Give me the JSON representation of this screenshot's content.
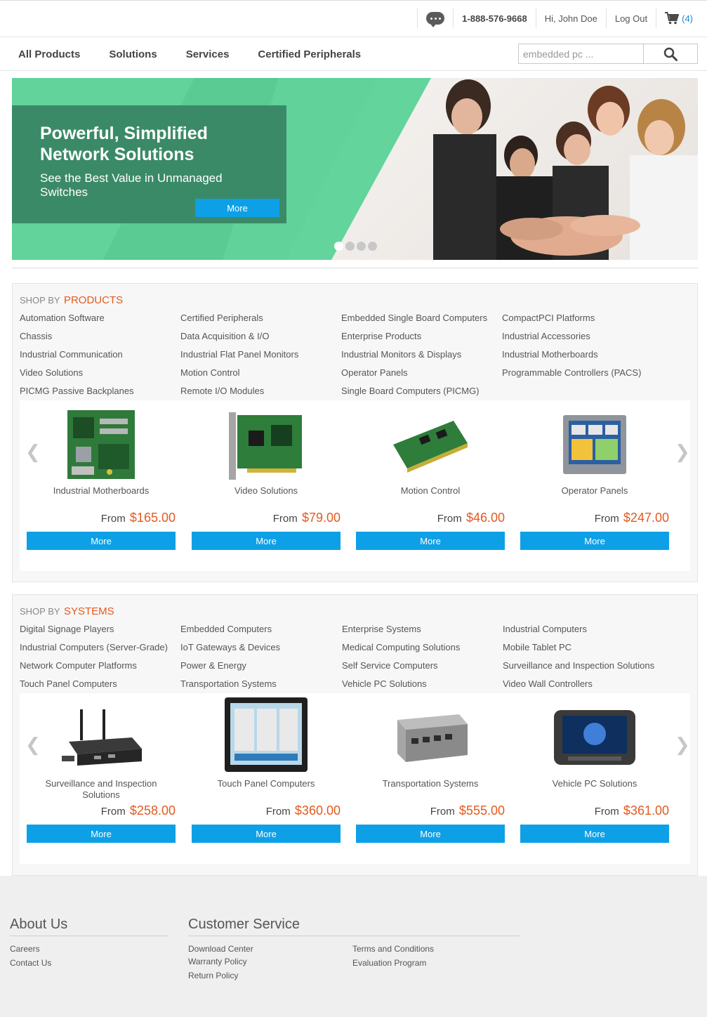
{
  "topbar": {
    "phone": "1-888-576-9668",
    "greeting": "Hi, John Doe",
    "logout": "Log Out",
    "cart_count": "(4)"
  },
  "nav": {
    "links": [
      "All Products",
      "Solutions",
      "Services",
      "Certified Peripherals"
    ],
    "search_placeholder": "embedded pc ..."
  },
  "hero": {
    "title": "Powerful, Simplified Network Solutions",
    "subtitle": "See the Best Value in Unmanaged Switches",
    "button": "More",
    "slide_count": 4,
    "active_slide": 1,
    "colors": {
      "green": "#5ccf96",
      "overlay": "#3b8a67",
      "button": "#0ea0e6"
    }
  },
  "products": {
    "shop_by": "SHOP BY",
    "heading": "PRODUCTS",
    "categories": [
      "Automation Software",
      "Certified Peripherals",
      "Embedded Single Board Computers",
      "CompactPCI Platforms",
      "Chassis",
      "Data Acquisition & I/O",
      "Enterprise Products",
      "Industrial Accessories",
      "Industrial Communication",
      "Industrial Flat Panel Monitors",
      "Industrial Monitors & Displays",
      "Industrial Motherboards",
      "Video Solutions",
      "Motion Control",
      "Operator Panels",
      "Programmable Controllers (PACS)",
      "PICMG Passive Backplanes",
      "Remote I/O Modules",
      "Single Board Computers (PICMG)"
    ],
    "cards": [
      {
        "name": "Industrial Motherboards",
        "price_prefix": "From",
        "price": "$165.00",
        "button": "More",
        "icon": "motherboard-icon"
      },
      {
        "name": "Video Solutions",
        "price_prefix": "From",
        "price": "$79.00",
        "button": "More",
        "icon": "video-card-icon"
      },
      {
        "name": "Motion Control",
        "price_prefix": "From",
        "price": "$46.00",
        "button": "More",
        "icon": "motion-card-icon"
      },
      {
        "name": "Operator Panels",
        "price_prefix": "From",
        "price": "$247.00",
        "button": "More",
        "icon": "operator-panel-icon"
      }
    ]
  },
  "systems": {
    "shop_by": "SHOP BY",
    "heading": "SYSTEMS",
    "categories": [
      "Digital Signage Players",
      "Embedded Computers",
      "Enterprise Systems",
      "Industrial Computers",
      "Industrial Computers (Server-Grade)",
      "IoT Gateways & Devices",
      "Medical Computing Solutions",
      "Mobile Tablet PC",
      "Network Computer Platforms",
      "Power & Energy",
      "Self Service Computers",
      "Surveillance and Inspection Solutions",
      "Touch Panel Computers",
      "Transportation Systems",
      "Vehicle PC Solutions",
      "Video Wall Controllers"
    ],
    "cards": [
      {
        "name": "Surveillance and Inspection Solutions",
        "price_prefix": "From",
        "price": "$258.00",
        "button": "More",
        "icon": "gateway-box-icon"
      },
      {
        "name": "Touch Panel Computers",
        "price_prefix": "From",
        "price": "$360.00",
        "button": "More",
        "icon": "touch-panel-icon"
      },
      {
        "name": "Transportation Systems",
        "price_prefix": "From",
        "price": "$555.00",
        "button": "More",
        "icon": "fanless-box-icon"
      },
      {
        "name": "Vehicle PC Solutions",
        "price_prefix": "From",
        "price": "$361.00",
        "button": "More",
        "icon": "vehicle-pc-icon"
      }
    ]
  },
  "carousel": {
    "prev": "❮",
    "next": "❯"
  },
  "footer": {
    "about": {
      "title": "About Us",
      "links": [
        "Careers",
        "Contact Us"
      ]
    },
    "service": {
      "title": "Customer Service",
      "links_left": [
        "Download Center",
        "Warranty Policy",
        "Return Policy"
      ],
      "links_right": [
        "Terms and Conditions",
        "Evaluation Program"
      ]
    }
  },
  "colors": {
    "accent_orange": "#e35a1f",
    "button_blue": "#0ea0e6",
    "cart_blue": "#1a8be0"
  }
}
